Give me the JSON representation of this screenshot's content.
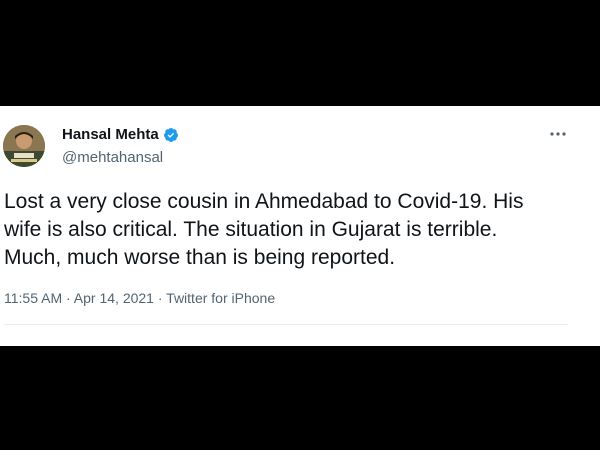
{
  "user": {
    "display_name": "Hansal Mehta",
    "handle": "@mehtahansal",
    "verified": true
  },
  "tweet": {
    "text": "Lost a very close cousin in Ahmedabad to Covid-19. His\nwife is also critical. The situation in Gujarat is terrible.\nMuch, much worse than is being reported.",
    "time": "11:55 AM",
    "date": "Apr 14, 2021",
    "source": "Twitter for iPhone",
    "separator": " · "
  },
  "icons": {
    "verified": "verified-badge-icon",
    "more": "more-options-icon"
  },
  "colors": {
    "verified_blue": "#1d9bf0",
    "text": "#0f1419",
    "secondary": "#536471"
  }
}
